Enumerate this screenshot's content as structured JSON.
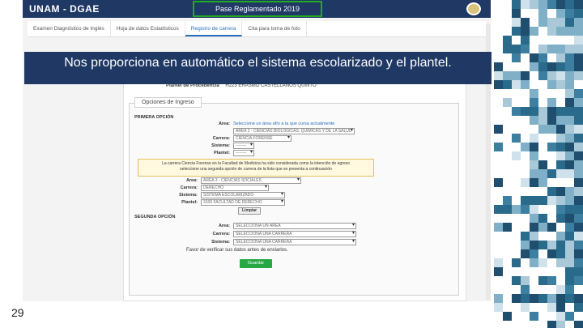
{
  "app": {
    "brand": "UNAM - DGAE",
    "badge": "Pase Reglamentado 2019"
  },
  "tabs": [
    {
      "label": "Examen Diagnóstico de Inglés"
    },
    {
      "label": "Hoja de datos Estadísticos"
    },
    {
      "label": "Registro de carrera"
    },
    {
      "label": "Cita para toma de foto"
    }
  ],
  "banner": {
    "text": "Nos proporciona en automático el sistema escolarizado y el plantel."
  },
  "plantel": {
    "label": "Plantel de Procedencia",
    "value": "H223 ERASMO CASTELLANOS QUINTO"
  },
  "form": {
    "legend": "Opciones de Ingreso",
    "first": {
      "title": "PRIMERA OPCIÓN",
      "area_label": "Area:",
      "area_hint": "Seleccione un área afín a la que cursa actualmente",
      "area_value": "ÁREA 2 - CIENCIAS BIOLÓGICAS, QUÍMICAS Y DE LA SALUD",
      "carrera_label": "Carrera:",
      "carrera_value": "CIENCIA FORENSE",
      "sistema_label": "Sistema:",
      "sistema_value": "--------",
      "plantel_label": "Plantel:",
      "plantel_value": "--------"
    },
    "notice": {
      "line1": "La carrera Ciencia Forense en la Facultad de Medicina ha sido considerada como la intención de egreso",
      "line2": "seleccione una segunda opción de carrera de la lista que se presenta a continuación"
    },
    "alt": {
      "area_label": "Area:",
      "area_value": "ÁREA 3 - CIENCIAS SOCIALES",
      "carrera_label": "Carrera:",
      "carrera_value": "DERECHO",
      "sistema_label": "Sistema:",
      "sistema_value": "SISTEMA ESCOLARIZADO",
      "plantel_label": "Plantel:",
      "plantel_value": "3100 FACULTAD DE DERECHO",
      "clear": "Limpiar"
    },
    "second": {
      "title": "SEGUNDA OPCIÓN",
      "area_label": "Area:",
      "area_value": "SELECCIONA UN ÁREA",
      "carrera_label": "Carrera:",
      "carrera_value": "SELECCIONA UNA CARRERA",
      "sistema_label": "Sistema:",
      "sistema_value": "SELECCIONA UNA CARRERA"
    },
    "verify": "Favor de verificar sus datos antes de enviarlos.",
    "send": "Guardar"
  },
  "slide_number": "29",
  "colors": {
    "navy": "#1f3864",
    "accent": "#2c6fbf",
    "green": "#27a845"
  }
}
